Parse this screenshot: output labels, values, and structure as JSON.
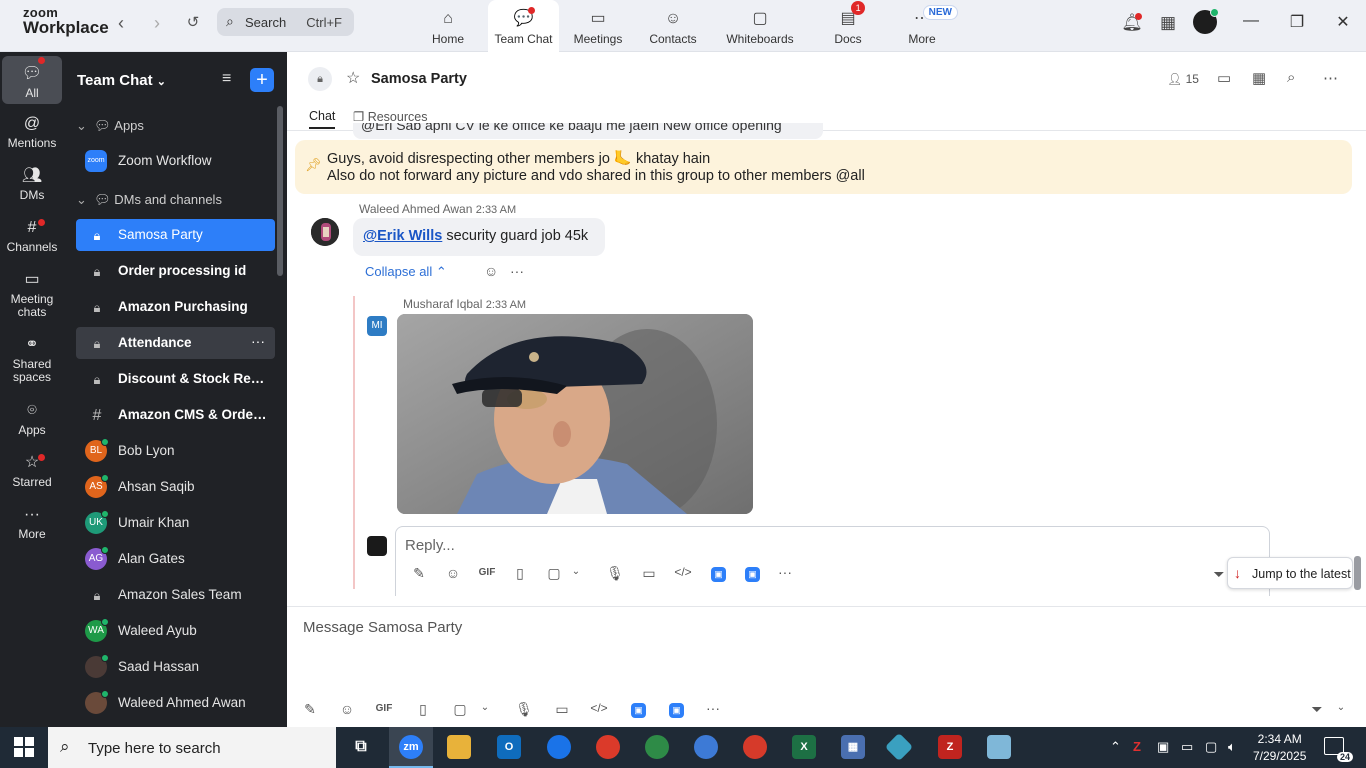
{
  "app": {
    "logo_top": "zoom",
    "logo_bottom": "Workplace"
  },
  "search": {
    "label": "Search",
    "shortcut": "Ctrl+F"
  },
  "tabs": [
    {
      "label": "Home",
      "icon": "home-icon"
    },
    {
      "label": "Team Chat",
      "icon": "chat-icon"
    },
    {
      "label": "Meetings",
      "icon": "video-icon"
    },
    {
      "label": "Contacts",
      "icon": "contacts-icon"
    },
    {
      "label": "Whiteboards",
      "icon": "whiteboard-icon"
    },
    {
      "label": "Docs",
      "icon": "docs-icon",
      "badge": "1"
    },
    {
      "label": "More",
      "icon": "more-icon",
      "new_badge": "NEW"
    }
  ],
  "rail": [
    {
      "label": "All"
    },
    {
      "label": "Mentions"
    },
    {
      "label": "DMs"
    },
    {
      "label": "Channels"
    },
    {
      "label": "Meeting chats"
    },
    {
      "label": "Shared spaces"
    },
    {
      "label": "Apps"
    },
    {
      "label": "Starred"
    },
    {
      "label": "More"
    }
  ],
  "sidebar": {
    "title": "Team Chat",
    "sections": {
      "apps": "Apps",
      "dms": "DMs and channels"
    },
    "zoom_app": {
      "icon_text": "zoom",
      "label": "Zoom Workflow"
    },
    "items": [
      {
        "name": "Samosa Party",
        "type": "lock"
      },
      {
        "name": "Order processing id",
        "type": "lock"
      },
      {
        "name": "Amazon Purchasing",
        "type": "lock"
      },
      {
        "name": "Attendance",
        "type": "lock"
      },
      {
        "name": "Discount & Stock Res...",
        "type": "lock"
      },
      {
        "name": "Amazon CMS & Order...",
        "type": "hash"
      },
      {
        "name": "Bob Lyon",
        "initials": "BL",
        "color": "#e0651c"
      },
      {
        "name": "Ahsan Saqib",
        "initials": "AS",
        "color": "#e0651c"
      },
      {
        "name": "Umair Khan",
        "initials": "UK",
        "color": "#1e9a78"
      },
      {
        "name": "Alan Gates",
        "initials": "AG",
        "color": "#8a5bd0"
      },
      {
        "name": "Amazon Sales Team",
        "type": "lock"
      },
      {
        "name": "Waleed Ayub",
        "initials": "WA",
        "color": "#1e9a48"
      },
      {
        "name": "Saad Hassan",
        "initials": "",
        "color": "#4a3a36"
      },
      {
        "name": "Waleed Ahmed Awan",
        "initials": "",
        "color": "#6a4a3a"
      }
    ]
  },
  "channel": {
    "name": "Samosa Party",
    "members": "15",
    "subtabs": [
      "Chat",
      "Resources"
    ]
  },
  "messages": {
    "cut_text": "@Eri  Sab apni CV le ke office ke baaju me jaein New office opening",
    "pinned_line1": "Guys, avoid disrespecting other members jo 🦶 khatay hain",
    "pinned_line2": "Also do not forward any picture and vdo shared in this group to other members @all",
    "msg1_sender": "Waleed Ahmed Awan",
    "msg1_time": "2:33 AM",
    "msg1_mention": "@Erik Wills",
    "msg1_text": " security guard job 45k",
    "collapse": "Collapse all",
    "reply_sender": "Musharaf Iqbal",
    "reply_time": "2:33 AM",
    "reply_initials": "MI",
    "reply_placeholder": "Reply...",
    "jump": "Jump to the latest",
    "composer_placeholder": "Message Samosa Party"
  },
  "toolbar": {
    "gif": "GIF"
  },
  "taskbar": {
    "search": "Type here to search",
    "time": "2:34 AM",
    "date": "7/29/2025",
    "notifications": "24"
  },
  "colors": {
    "accent": "#2d7ff9",
    "sidebar_bg": "#202226",
    "pinned_bg": "#fdf3dc"
  }
}
